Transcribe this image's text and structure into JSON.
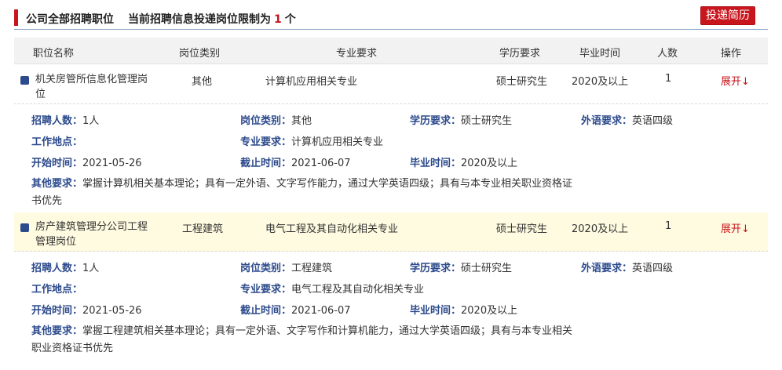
{
  "header": {
    "title": "公司全部招聘职位",
    "notice_prefix": "当前招聘信息投递岗位限制为",
    "notice_count": "1",
    "notice_suffix": "个",
    "submit_label": "投递简历"
  },
  "colors": {
    "accent": "#c8161d",
    "label_blue": "#2c4a8c",
    "highlight_row": "#fffbe0"
  },
  "table": {
    "columns": [
      "职位名称",
      "岗位类别",
      "专业要求",
      "学历要求",
      "毕业时间",
      "人数",
      "操作"
    ]
  },
  "jobs": [
    {
      "name": "机关房管所信息化管理岗位",
      "category": "其他",
      "major": "计算机应用相关专业",
      "education": "硕士研究生",
      "graduation": "2020及以上",
      "count": "1",
      "action": "展开↓",
      "details": {
        "count_label": "招聘人数：",
        "count_value": "1人",
        "category_label": "岗位类别：",
        "category_value": "其他",
        "education_label": "学历要求：",
        "education_value": "硕士研究生",
        "language_label": "外语要求：",
        "language_value": "英语四级",
        "location_label": "工作地点：",
        "location_value": "",
        "major_label": "专业要求：",
        "major_value": "计算机应用相关专业",
        "start_label": "开始时间：",
        "start_value": "2021-05-26",
        "end_label": "截止时间：",
        "end_value": "2021-06-07",
        "graduation_label": "毕业时间：",
        "graduation_value": "2020及以上",
        "other_label": "其他要求：",
        "other_value": "掌握计算机相关基本理论；具有一定外语、文字写作能力，通过大学英语四级；具有与本专业相关职业资格证书优先"
      }
    },
    {
      "name": "房产建筑管理分公司工程管理岗位",
      "category": "工程建筑",
      "major": "电气工程及其自动化相关专业",
      "education": "硕士研究生",
      "graduation": "2020及以上",
      "count": "1",
      "action": "展开↓",
      "details": {
        "count_label": "招聘人数：",
        "count_value": "1人",
        "category_label": "岗位类别：",
        "category_value": "工程建筑",
        "education_label": "学历要求：",
        "education_value": "硕士研究生",
        "language_label": "外语要求：",
        "language_value": "英语四级",
        "location_label": "工作地点：",
        "location_value": "",
        "major_label": "专业要求：",
        "major_value": "电气工程及其自动化相关专业",
        "start_label": "开始时间：",
        "start_value": "2021-05-26",
        "end_label": "截止时间：",
        "end_value": "2021-06-07",
        "graduation_label": "毕业时间：",
        "graduation_value": "2020及以上",
        "other_label": "其他要求：",
        "other_value": "掌握工程建筑相关基本理论；具有一定外语、文字写作和计算机能力，通过大学英语四级；具有与本专业相关职业资格证书优先"
      }
    }
  ]
}
